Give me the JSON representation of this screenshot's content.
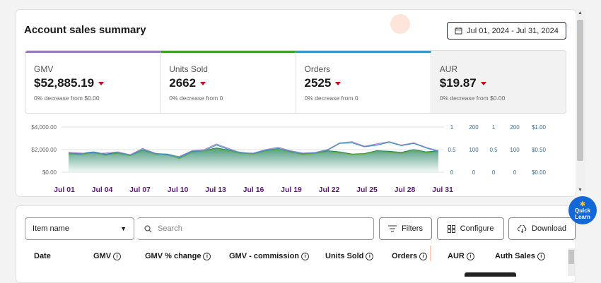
{
  "summary": {
    "title": "Account sales summary",
    "date_range": "Jul 01, 2024 - Jul 31, 2024"
  },
  "metrics": [
    {
      "label": "GMV",
      "value": "$52,885.19",
      "sub": "0% decrease from $0.00",
      "color": "#9b7bbf"
    },
    {
      "label": "Units Sold",
      "value": "2662",
      "sub": "0% decrease from 0",
      "color": "#43a02f"
    },
    {
      "label": "Orders",
      "value": "2525",
      "sub": "0% decrease from 0",
      "color": "#3a9ac8"
    },
    {
      "label": "AUR",
      "value": "$19.87",
      "sub": "0% decrease from $0.00",
      "color": "#f2f2f2"
    }
  ],
  "chart_data": {
    "type": "area",
    "x_ticks": [
      "Jul 01",
      "Jul 04",
      "Jul 07",
      "Jul 10",
      "Jul 13",
      "Jul 16",
      "Jul 19",
      "Jul 22",
      "Jul 25",
      "Jul 28",
      "Jul 31"
    ],
    "y_left_ticks": [
      "$4,000.00",
      "$2,000.00",
      "$0.00"
    ],
    "y_right_axes": [
      [
        "1",
        "0.5",
        "0"
      ],
      [
        "200",
        "100",
        "0"
      ],
      [
        "1",
        "0.5",
        "0"
      ],
      [
        "200",
        "100",
        "0"
      ],
      [
        "$1.00",
        "$0.50",
        "$0.00"
      ]
    ],
    "ylim": [
      0,
      4000
    ],
    "series": [
      {
        "values": [
          1700,
          1650,
          1800,
          1600,
          1750,
          1500,
          2000,
          1650,
          1600,
          1350,
          1850,
          1900,
          2150,
          1950,
          1750,
          1650,
          1900,
          2100,
          1850,
          1600,
          1700,
          1900,
          1800,
          1600,
          1650,
          1900,
          1850,
          1750,
          2000,
          1800,
          1900
        ],
        "color": "#2e8b6b"
      },
      {
        "values": [
          1750,
          1700,
          1650,
          1700,
          1800,
          1550,
          2100,
          1700,
          1500,
          1400,
          1900,
          2000,
          2500,
          2100,
          1700,
          1700,
          2000,
          2200,
          1900,
          1700,
          1750,
          2000,
          2600,
          2700,
          2300,
          2500,
          2700,
          2400,
          2600,
          2200,
          1900
        ],
        "color": "#a78bc7"
      },
      {
        "values": [
          1600,
          1550,
          1700,
          1500,
          1650,
          1450,
          1900,
          1600,
          1550,
          1200,
          1750,
          1850,
          2050,
          1850,
          1650,
          1600,
          1850,
          2000,
          1750,
          1550,
          1650,
          1800,
          1700,
          1550,
          1600,
          1800,
          1750,
          1650,
          1900,
          1700,
          1800
        ],
        "color": "#6fae3c"
      },
      {
        "values": [
          1650,
          1600,
          1750,
          1550,
          1700,
          1500,
          1950,
          1650,
          1550,
          1300,
          1800,
          1900,
          2400,
          2000,
          1700,
          1650,
          1950,
          2100,
          1800,
          1650,
          1700,
          1950,
          2550,
          2600,
          2250,
          2400,
          2650,
          2350,
          2550,
          2150,
          1850
        ],
        "color": "#3c96c4"
      }
    ]
  },
  "table": {
    "select_value": "Item name",
    "search_placeholder": "Search",
    "filters_label": "Filters",
    "configure_label": "Configure",
    "download_label": "Download",
    "columns": [
      "Date",
      "GMV",
      "GMV % change",
      "GMV - commission",
      "Units Sold",
      "Orders",
      "AUR",
      "Auth Sales"
    ]
  },
  "quick_learn": {
    "line1": "Quick",
    "line2": "Learn"
  }
}
